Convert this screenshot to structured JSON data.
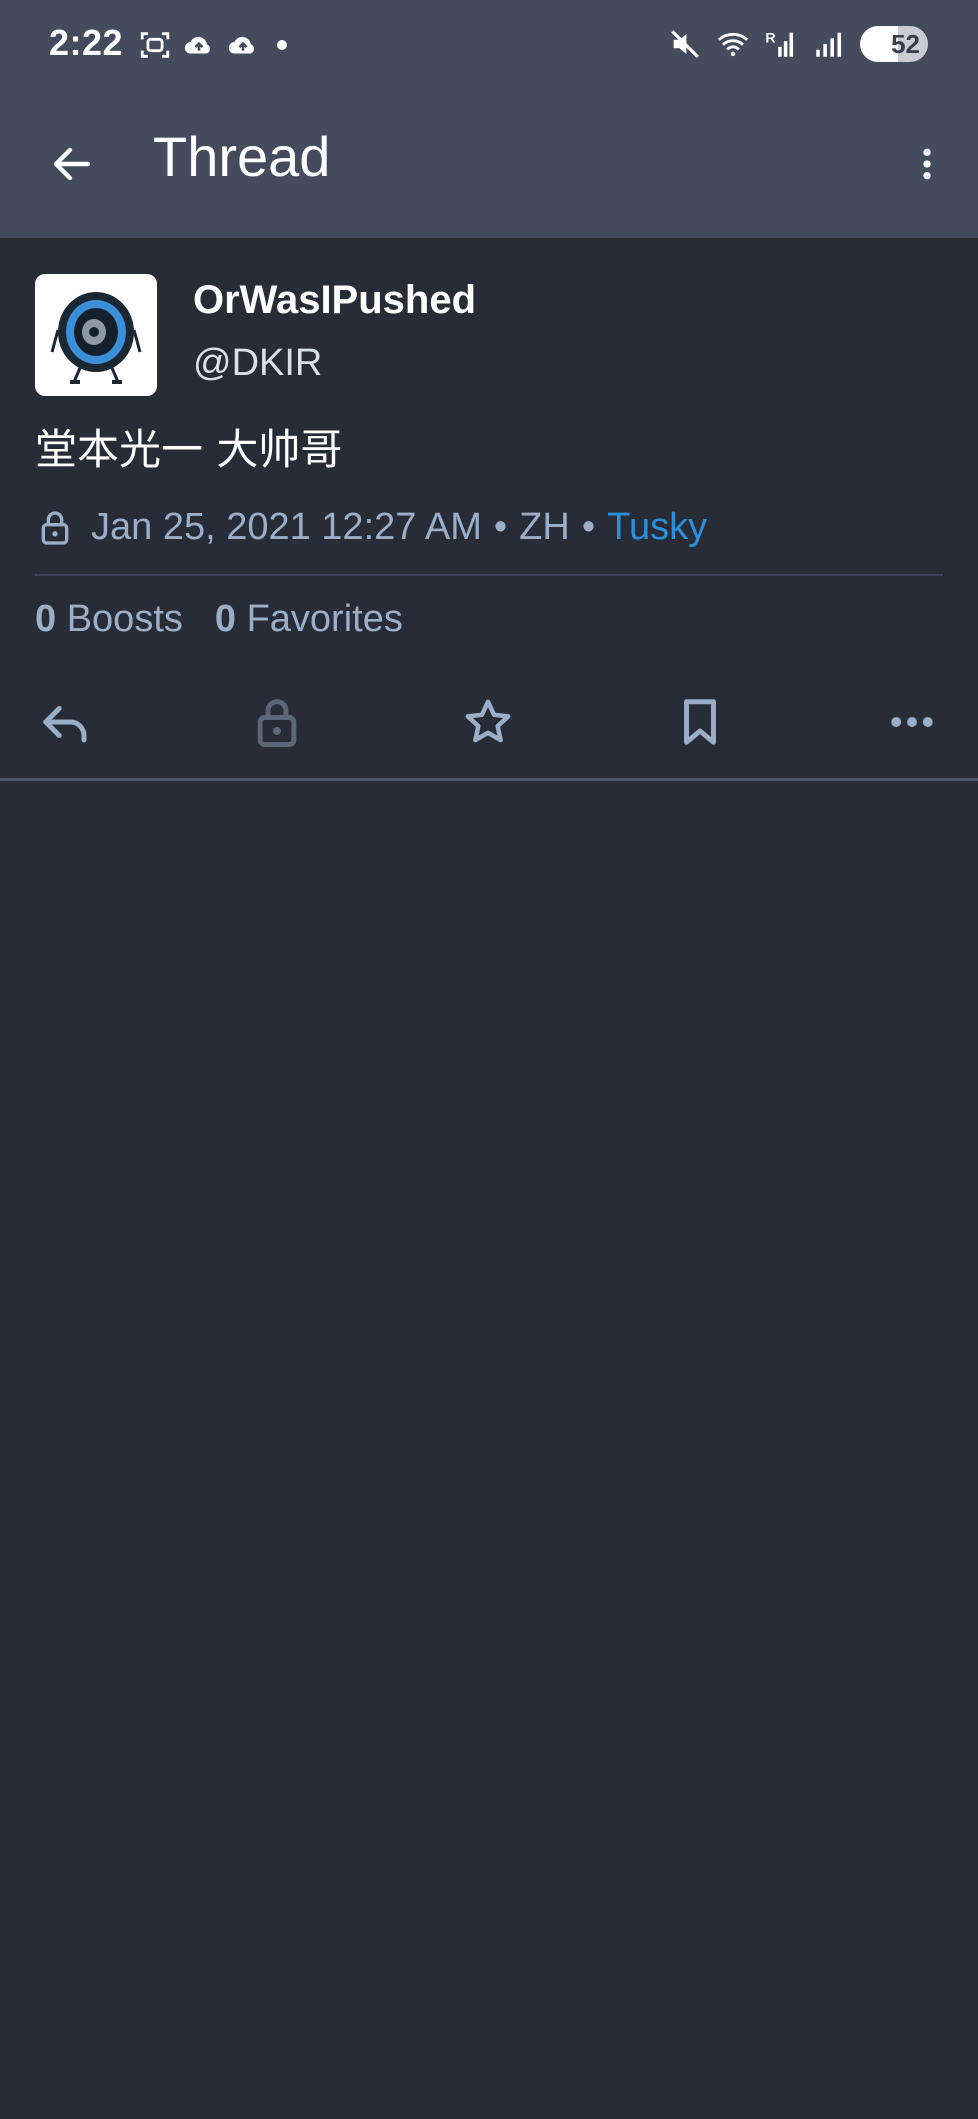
{
  "status_bar": {
    "time": "2:22",
    "battery": "52",
    "left_icons": [
      "screenshot-icon",
      "cloud-upload-icon",
      "cloud-upload-icon",
      "dot-icon"
    ],
    "right_icons": [
      "mute-icon",
      "wifi-icon",
      "signal-r-icon",
      "signal-icon"
    ]
  },
  "app_bar": {
    "title": "Thread",
    "back_icon": "arrow-left-icon",
    "menu_icon": "more-vert-icon"
  },
  "status": {
    "display_name": "OrWasIPushed",
    "username": "@DKIR",
    "content": "堂本光一 大帅哥",
    "visibility_icon": "lock-icon",
    "timestamp": "Jan 25, 2021 12:27 AM",
    "separator": "•",
    "language": "ZH",
    "application": "Tusky",
    "boosts_count": "0",
    "boosts_label": "Boosts",
    "favorites_count": "0",
    "favorites_label": "Favorites"
  },
  "actions": [
    "reply-icon",
    "lock-icon",
    "star-icon",
    "bookmark-icon",
    "more-horiz-icon"
  ],
  "colors": {
    "background": "#282c37",
    "app_bar": "#444b5d",
    "text_secondary": "#9baec8",
    "link": "#2b90d9"
  }
}
